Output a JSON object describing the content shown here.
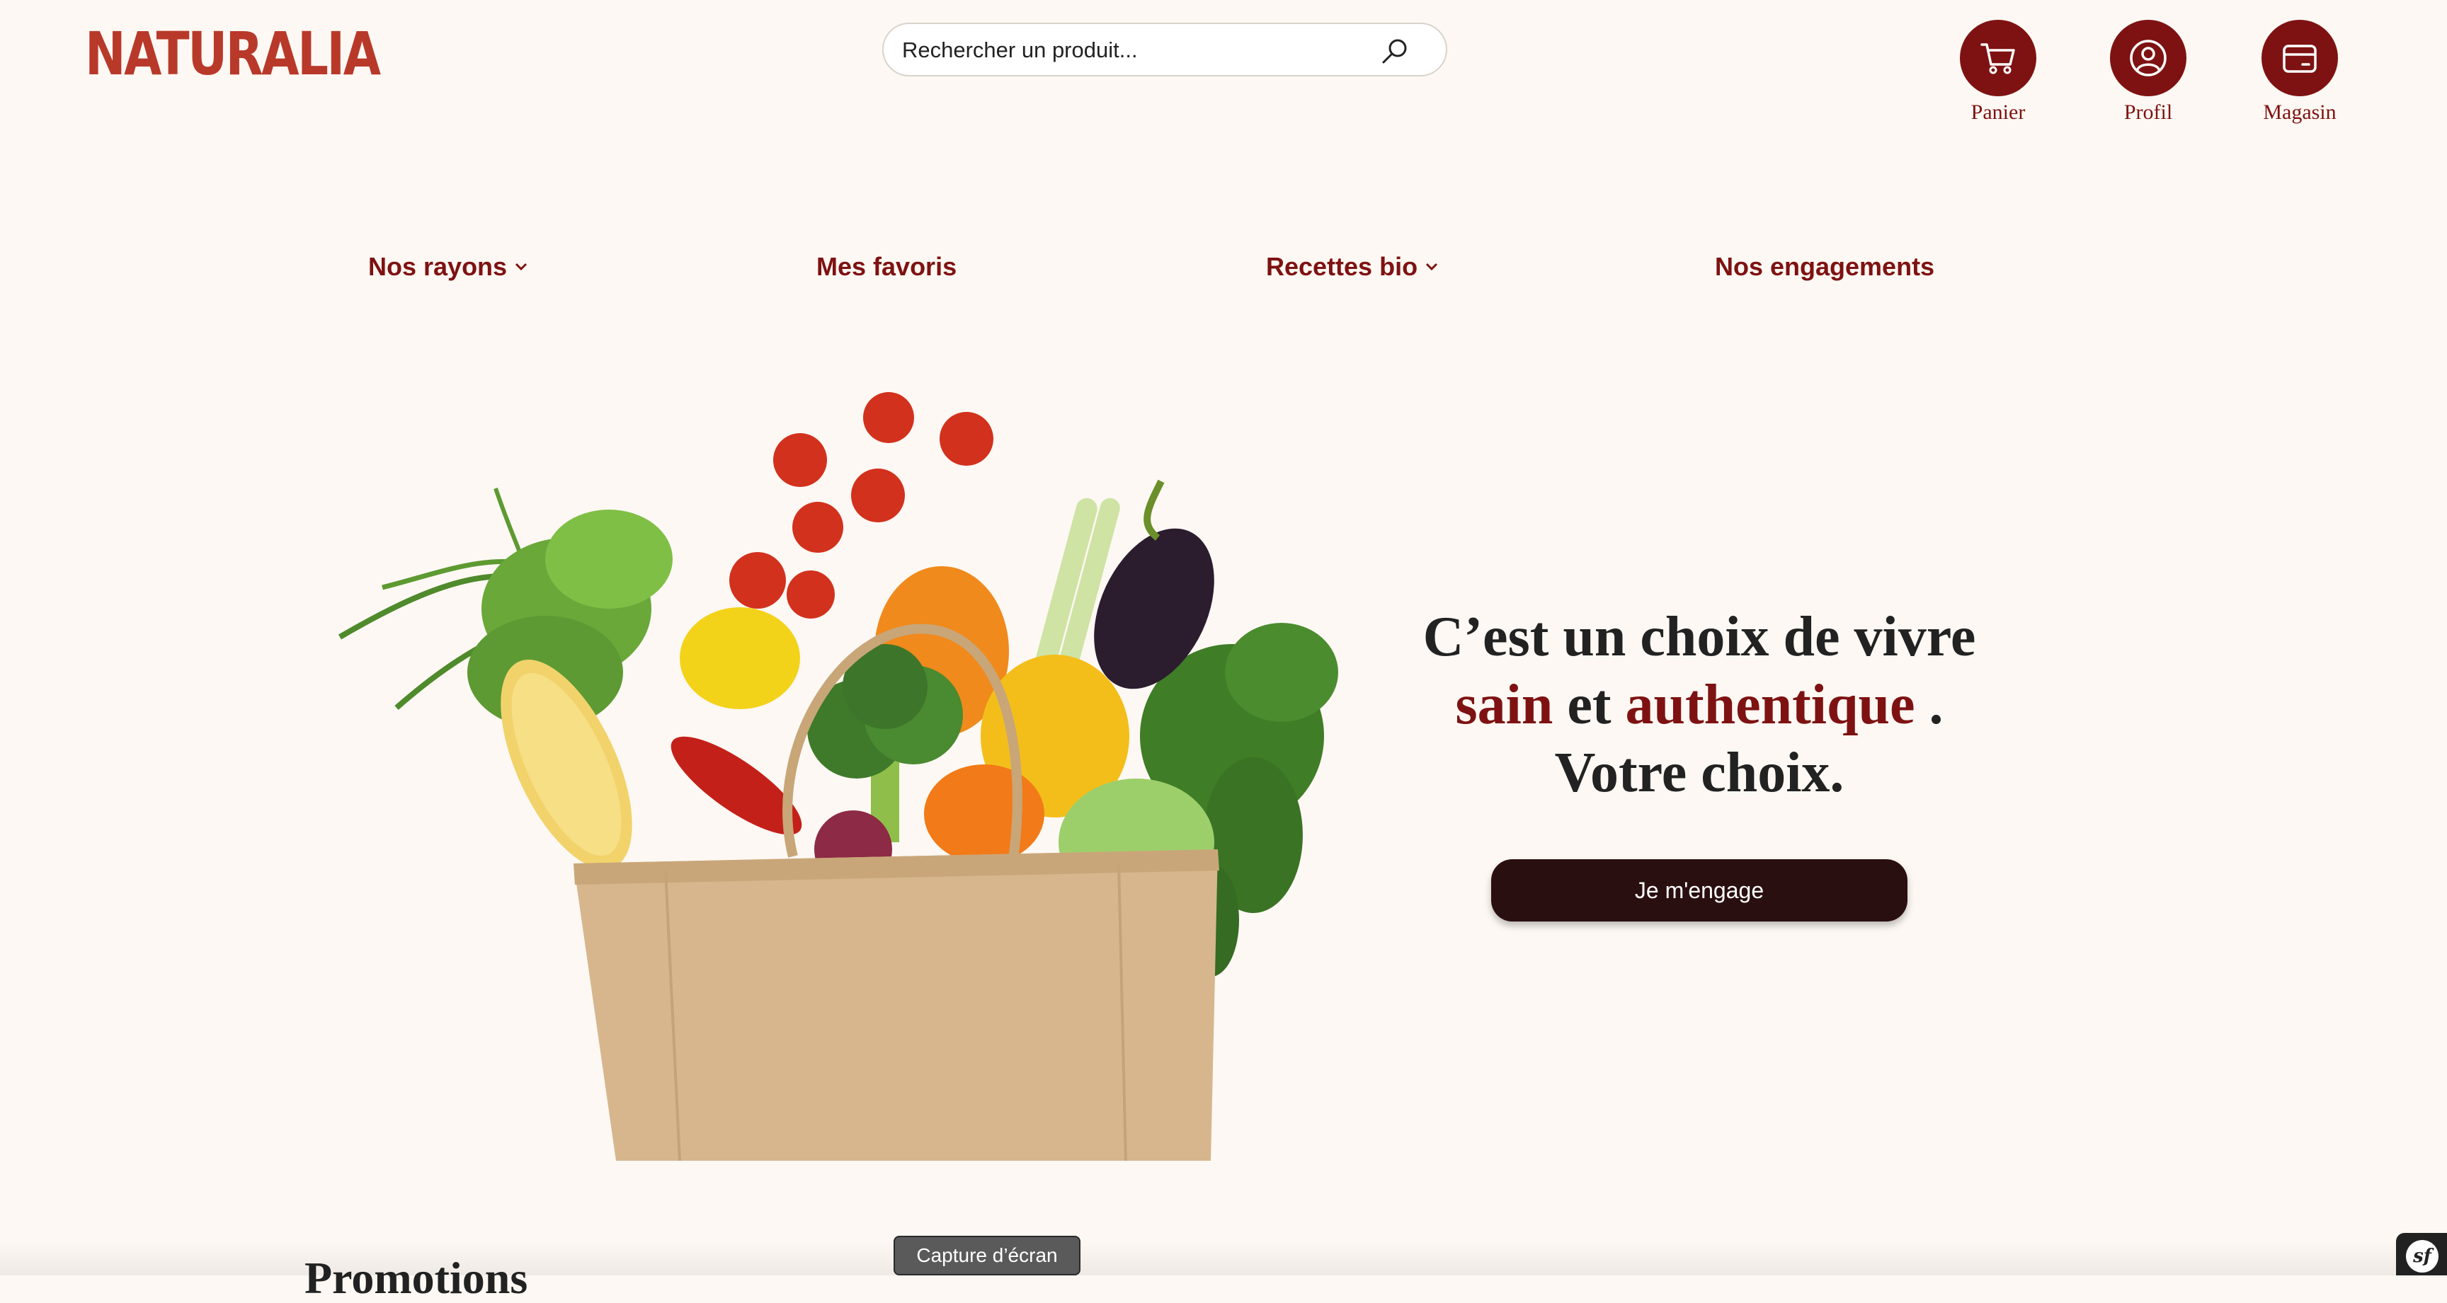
{
  "header": {
    "logo": "NATURALIA",
    "search_placeholder": "Rechercher un produit...",
    "actions": [
      {
        "label": "Panier",
        "icon": "cart-icon"
      },
      {
        "label": "Profil",
        "icon": "user-icon"
      },
      {
        "label": "Magasin",
        "icon": "store-icon"
      }
    ]
  },
  "nav": {
    "items": [
      {
        "label": "Nos rayons",
        "dropdown": true
      },
      {
        "label": "Mes favoris",
        "dropdown": false
      },
      {
        "label": "Recettes bio",
        "dropdown": true
      },
      {
        "label": "Nos engagements",
        "dropdown": false
      }
    ]
  },
  "hero": {
    "line1": "C’est un choix de vivre",
    "highlight1": "sain",
    "connector": "et",
    "highlight2": "authentique",
    "period": ".",
    "line3": "Votre choix.",
    "cta": "Je m'engage",
    "image_icon": "grocery-bag-illustration"
  },
  "section": {
    "title": "Promotions"
  },
  "overlay": {
    "tooltip": "Capture d’écran",
    "badge": "sf"
  },
  "colors": {
    "background": "#fdf8f3",
    "brand": "#b8392a",
    "primary": "#7e1212",
    "cta": "#2a0f10",
    "text": "#222222"
  }
}
